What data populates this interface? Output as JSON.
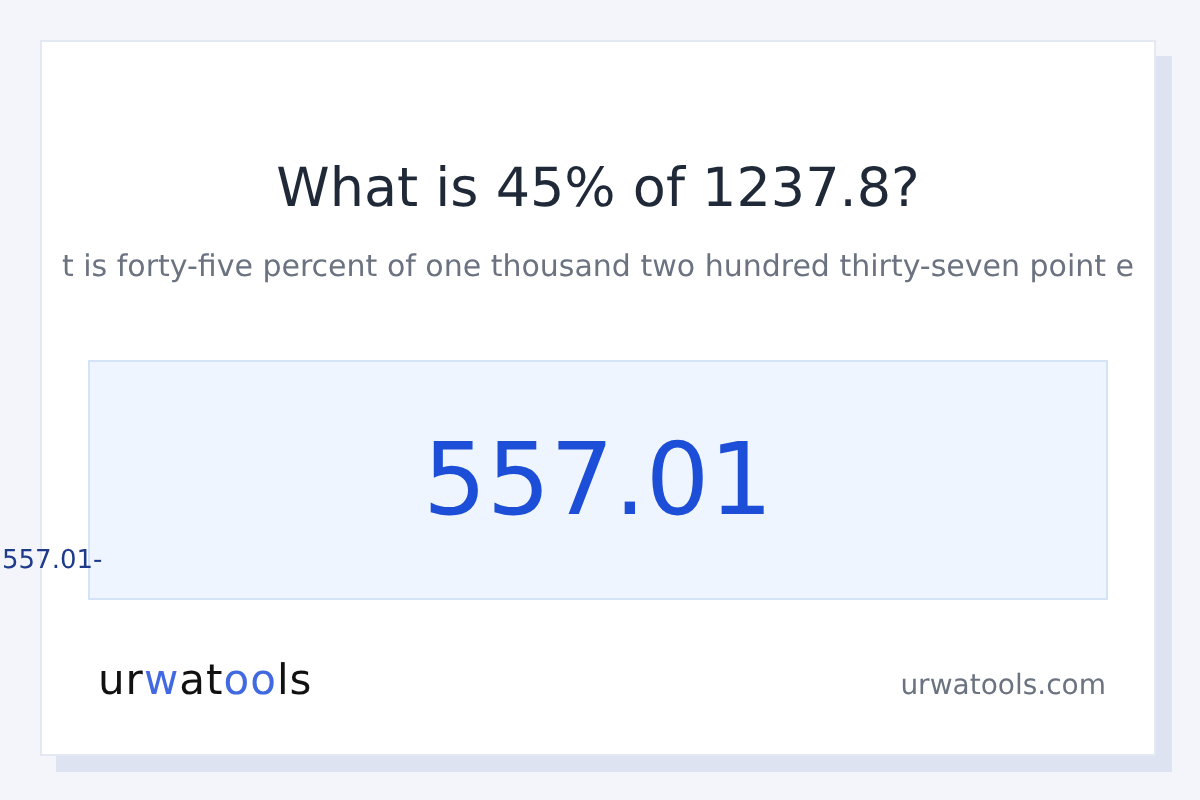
{
  "title": "What is 45% of 1237.8?",
  "subtitle": "t is forty-five percent of one thousand two hundred thirty-seven point e",
  "result": "557.01",
  "side_label": "557.01-",
  "logo": {
    "parts": [
      {
        "text": "ur",
        "accent": false
      },
      {
        "text": "w",
        "accent": true
      },
      {
        "text": "at",
        "accent": false
      },
      {
        "text": "oo",
        "accent": true
      },
      {
        "text": "ls",
        "accent": false
      }
    ]
  },
  "domain": "urwatools.com"
}
